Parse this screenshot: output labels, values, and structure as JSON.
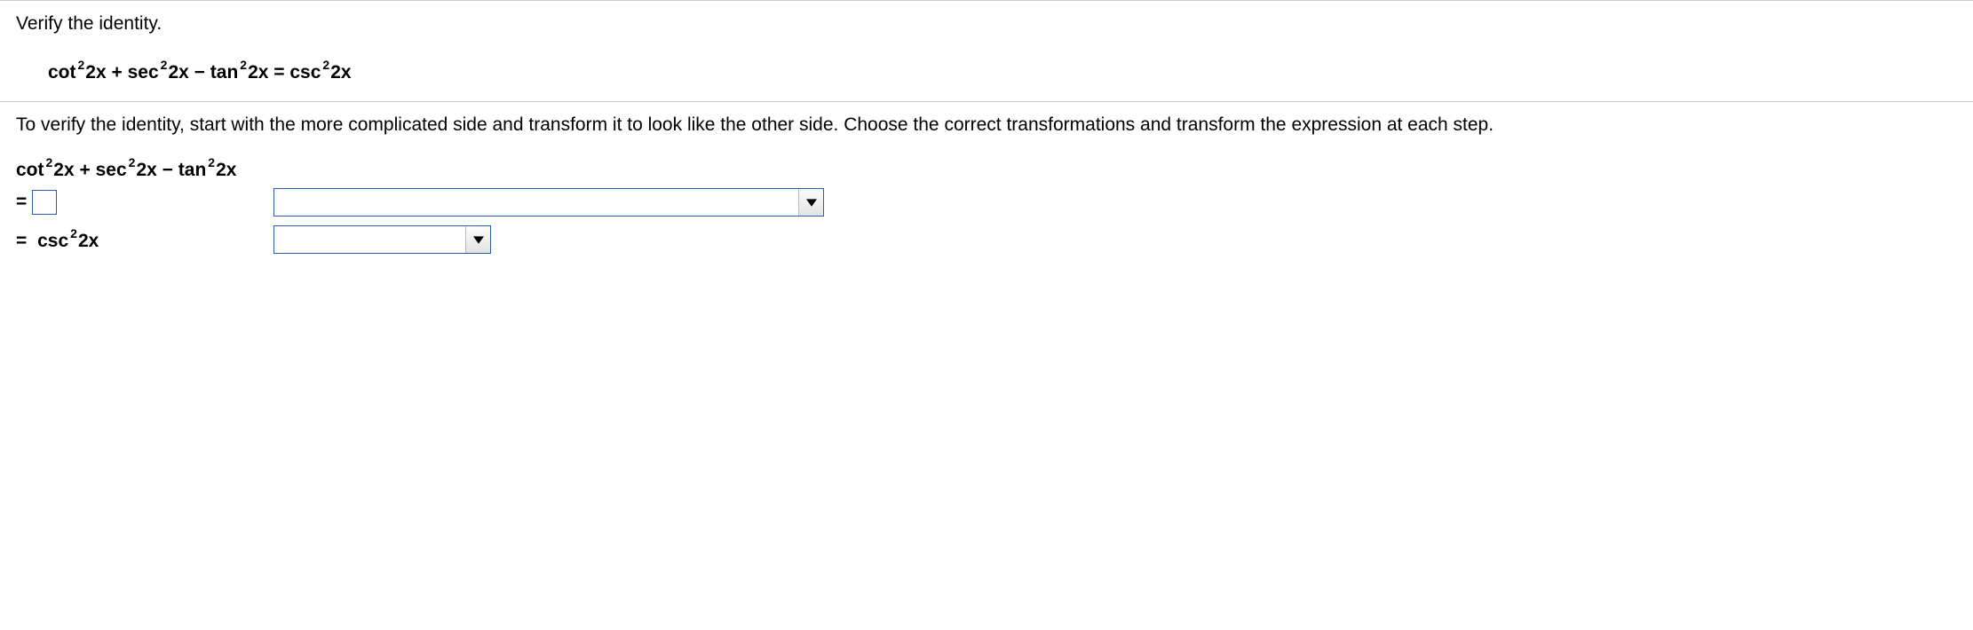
{
  "problem": {
    "instruction": "Verify the identity.",
    "identity": {
      "term1_fn": "cot",
      "term1_exp": "2",
      "term1_arg": "2x",
      "op1": "+",
      "term2_fn": "sec",
      "term2_exp": "2",
      "term2_arg": "2x",
      "op2": "−",
      "term3_fn": "tan",
      "term3_exp": "2",
      "term3_arg": "2x",
      "eq": "=",
      "rhs_fn": "csc",
      "rhs_exp": "2",
      "rhs_arg": "2x"
    }
  },
  "directions": "To verify the identity, start with the more complicated side and transform it to look like the other side. Choose the correct transformations and transform the expression at each step.",
  "start_expr": {
    "term1_fn": "cot",
    "term1_exp": "2",
    "term1_arg": "2x",
    "op1": "+",
    "term2_fn": "sec",
    "term2_exp": "2",
    "term2_arg": "2x",
    "op2": "−",
    "term3_fn": "tan",
    "term3_exp": "2",
    "term3_arg": "2x"
  },
  "step1": {
    "eq": "=",
    "input_value": "",
    "dropdown_value": ""
  },
  "step2": {
    "eq": "=",
    "result_fn": "csc",
    "result_exp": "2",
    "result_arg": "2x",
    "dropdown_value": ""
  }
}
